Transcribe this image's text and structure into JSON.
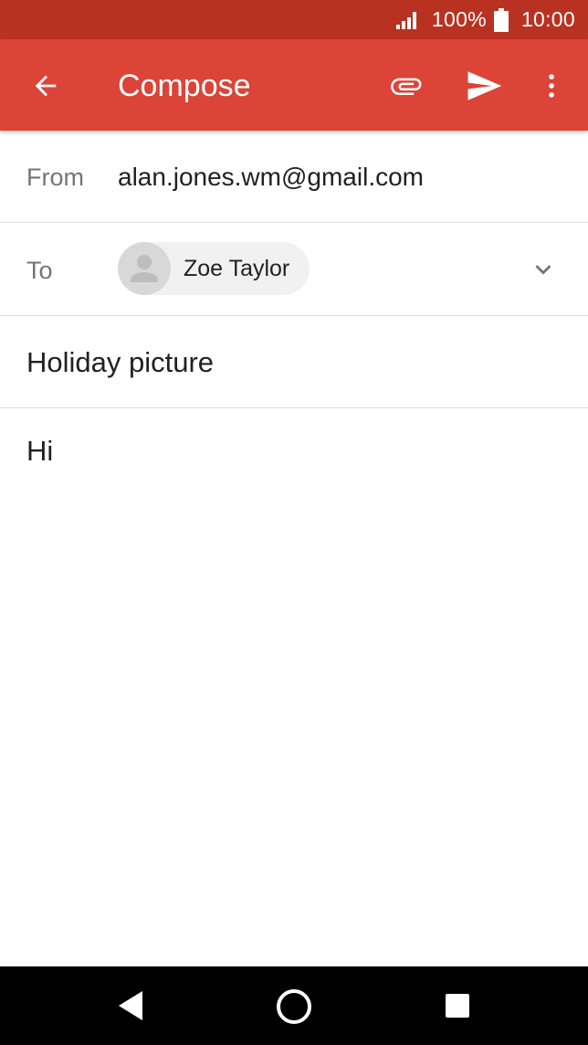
{
  "status_bar": {
    "battery_percent": "100%",
    "time": "10:00",
    "icons": [
      "signal-icon",
      "battery-icon"
    ]
  },
  "app_bar": {
    "title": "Compose",
    "icons": [
      "back-arrow-icon",
      "paperclip-icon",
      "send-icon",
      "more-vert-icon"
    ],
    "background_color": "#db4437"
  },
  "compose": {
    "from_label": "From",
    "from_value": "alan.jones.wm@gmail.com",
    "to_label": "To",
    "recipients": [
      {
        "name": "Zoe Taylor",
        "icon": "person-icon"
      }
    ],
    "subject": "Holiday picture",
    "body": "Hi"
  },
  "nav_bar": {
    "icons": [
      "nav-back-icon",
      "nav-home-icon",
      "nav-recents-icon"
    ]
  }
}
